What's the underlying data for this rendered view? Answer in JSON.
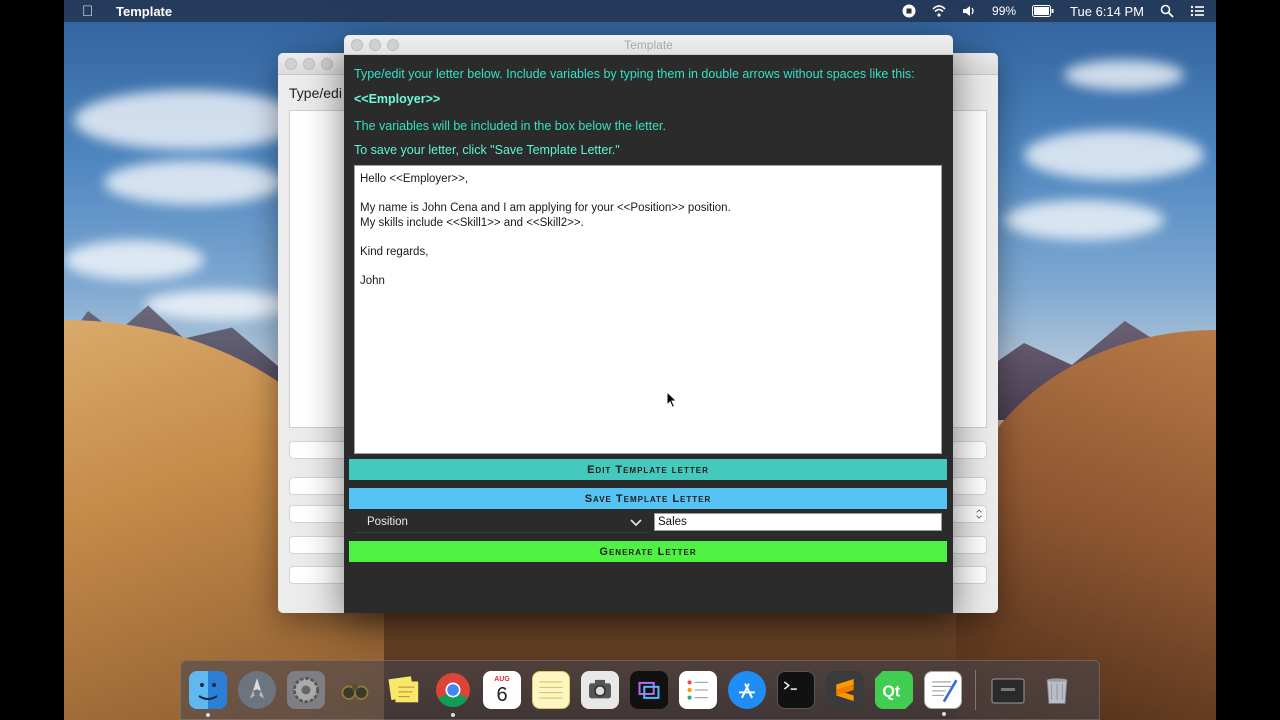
{
  "menubar": {
    "app_name": "Template",
    "battery": "99%",
    "clock": "Tue 6:14 PM"
  },
  "back_window": {
    "label": "Type/edi"
  },
  "window": {
    "title": "Template",
    "instructions": [
      "Type/edit your letter below. Include variables by typing them in double arrows without spaces like this:",
      "<<Employer>>",
      "The variables will be included in the box below the letter.",
      "To save your letter, click \"Save Template Letter.\""
    ],
    "letter_lines": [
      "Hello <<Employer>>,",
      "",
      "My name is John Cena and I am applying for your <<Position>> position.",
      "My skills include <<Skill1>> and <<Skill2>>.",
      "",
      "Kind regards,",
      "",
      "John"
    ],
    "edit_button": "Edit Template letter",
    "save_button": "Save Template Letter",
    "variable_select": "Position",
    "variable_value": "Sales",
    "generate_button": "Generate Letter"
  },
  "dock": {
    "calendar_month": "AUG",
    "calendar_day": "6",
    "items": [
      "finder-icon",
      "launchpad-icon",
      "system-preferences-icon",
      "binoculars-icon",
      "stickies-icon",
      "chrome-icon",
      "calendar-icon",
      "notes-icon",
      "screenshot-icon",
      "screen-recorder-icon",
      "reminders-icon",
      "app-store-icon",
      "terminal-icon",
      "sublime-text-icon",
      "qt-creator-icon",
      "textedit-icon",
      "archive-icon",
      "trash-icon"
    ]
  },
  "colors": {
    "instruction_text": "#35e0c4",
    "edit_button": "#45c9bd",
    "save_button": "#55c3f3",
    "generate_button": "#4ff142",
    "window_bg": "#2b2b2b"
  }
}
